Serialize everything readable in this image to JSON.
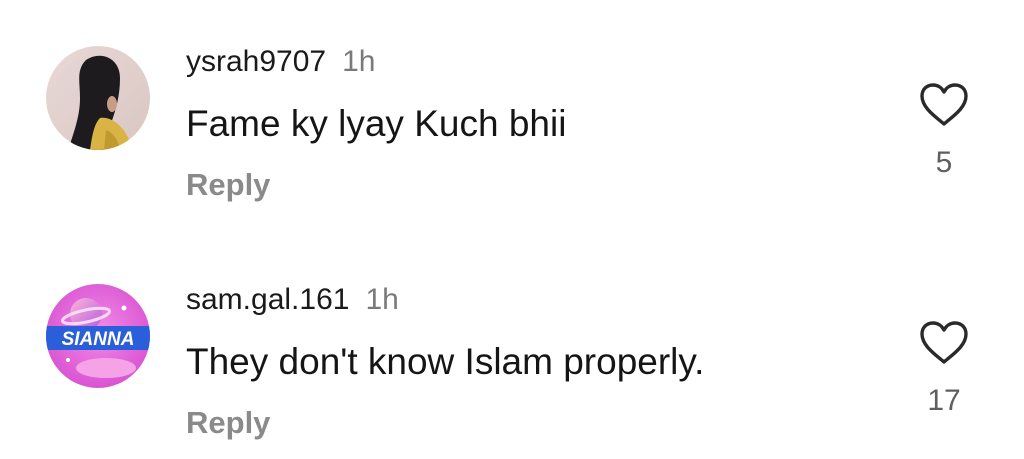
{
  "comments": [
    {
      "username": "ysrah9707",
      "time": "1h",
      "text": "Fame ky lyay Kuch bhii",
      "reply_label": "Reply",
      "like_count": "5",
      "avatar_icon": "profile-photo-girl-long-hair"
    },
    {
      "username": "sam.gal.161",
      "time": "1h",
      "text": "They don't know Islam properly.",
      "reply_label": "Reply",
      "like_count": "17",
      "avatar_icon": "sianna-logo",
      "avatar_logo_text": "SIANNA"
    }
  ],
  "colors": {
    "text": "#1a1a1a",
    "muted": "#8a8a8a",
    "heart_stroke": "#2a2a2a",
    "logo_bg": "#e860d8"
  }
}
